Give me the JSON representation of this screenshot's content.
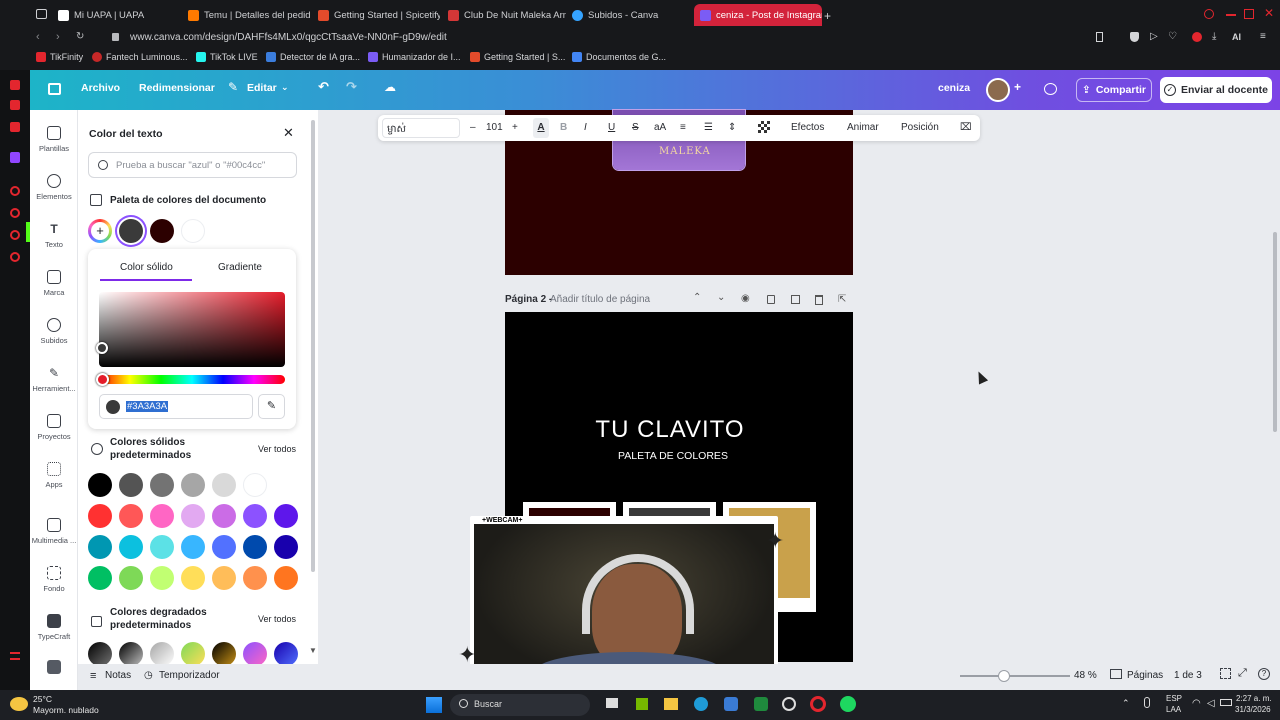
{
  "browser": {
    "tabs": [
      {
        "label": "Mi UAPA | UAPA",
        "color": "#ffffff"
      },
      {
        "label": "Temu | Detalles del pedido",
        "color": "#ff7a00"
      },
      {
        "label": "Getting Started | Spicetify",
        "color": "#e34b2b"
      },
      {
        "label": "Club De Nuit Maleka Arma",
        "color": "#d43737"
      },
      {
        "label": "Subidos - Canva",
        "color": "#35a3ff"
      },
      {
        "label": "ceniza - Post de Instagram",
        "color": "#7b5cf5"
      }
    ],
    "url": "www.canva.com/design/DAHFfs4MLx0/qgcCtTsaaVe-NN0nF-gD9w/edit",
    "bookmarks": [
      "TikFinity",
      "Fantech Luminous...",
      "TikTok LIVE",
      "Detector de IA gra...",
      "Humanizador de I...",
      "Getting Started | S...",
      "Documentos de G..."
    ]
  },
  "topbar": {
    "file": "Archivo",
    "resize": "Redimensionar",
    "edit": "Editar",
    "title": "ceniza",
    "share": "Compartir",
    "send": "Enviar al docente"
  },
  "sidenav": [
    "Plantillas",
    "Elementos",
    "Texto",
    "Marca",
    "Subidos",
    "Herramient...",
    "Proyectos",
    "Apps",
    "Multimedia ...",
    "Fondo",
    "TypeCraft"
  ],
  "panel": {
    "title": "Color del texto",
    "search_placeholder": "Prueba a buscar \"azul\" o \"#00c4cc\"",
    "doc_palette": "Paleta de colores del documento",
    "doc_colors": [
      "#3a3a3a",
      "#2c0000",
      "#ffffff"
    ],
    "tab_solid": "Color sólido",
    "tab_gradient": "Gradiente",
    "hex": "#3A3A3A",
    "solid_title": "Colores sólidos predeterminados",
    "solid_title2": "predeterminados",
    "solid_title1": "Colores sólidos",
    "see_all": "Ver todos",
    "grad_title1": "Colores degradados",
    "grad_title2": "predeterminados",
    "solid_colors": [
      [
        "#000000",
        "#545454",
        "#737373",
        "#a6a6a6",
        "#d9d9d9",
        "#ffffff"
      ],
      [
        "#ff3131",
        "#ff5757",
        "#ff66c4",
        "#e2a9f1",
        "#cb6ce6",
        "#8c52ff",
        "#5e17eb"
      ],
      [
        "#0097b2",
        "#0cc0df",
        "#5ce1e6",
        "#38b6ff",
        "#5271ff",
        "#004aad",
        "#1800ad"
      ],
      [
        "#00bf63",
        "#7ed957",
        "#c1ff72",
        "#ffde59",
        "#ffbd59",
        "#ff914d",
        "#ff751f"
      ]
    ]
  },
  "toolbar": {
    "font": "ម្ចាស់",
    "size": "101",
    "effects": "Efectos",
    "animate": "Animar",
    "position": "Posición"
  },
  "page1": {
    "logo": "MALEKA"
  },
  "page2": {
    "label": "Página 2 - ",
    "title_placeholder": "Añadir título de página",
    "heading": "TU CLAVITO",
    "subheading": "PALETA DE COLORES",
    "swatches": [
      "#2c0000",
      "#3a3a3a",
      "#c9a14b"
    ]
  },
  "footer": {
    "notes": "Notas",
    "timer": "Temporizador",
    "zoom": "48 %",
    "pages": "Páginas",
    "page_count": "1 de 3"
  },
  "webcam": {
    "label": "+WEBCAM+"
  },
  "taskbar": {
    "temp": "25°C",
    "weather": "Mayorm. nublado",
    "search": "Buscar",
    "lang1": "ESP",
    "lang2": "LAA",
    "time": "2:27 a. m.",
    "date": "31/3/2026"
  }
}
